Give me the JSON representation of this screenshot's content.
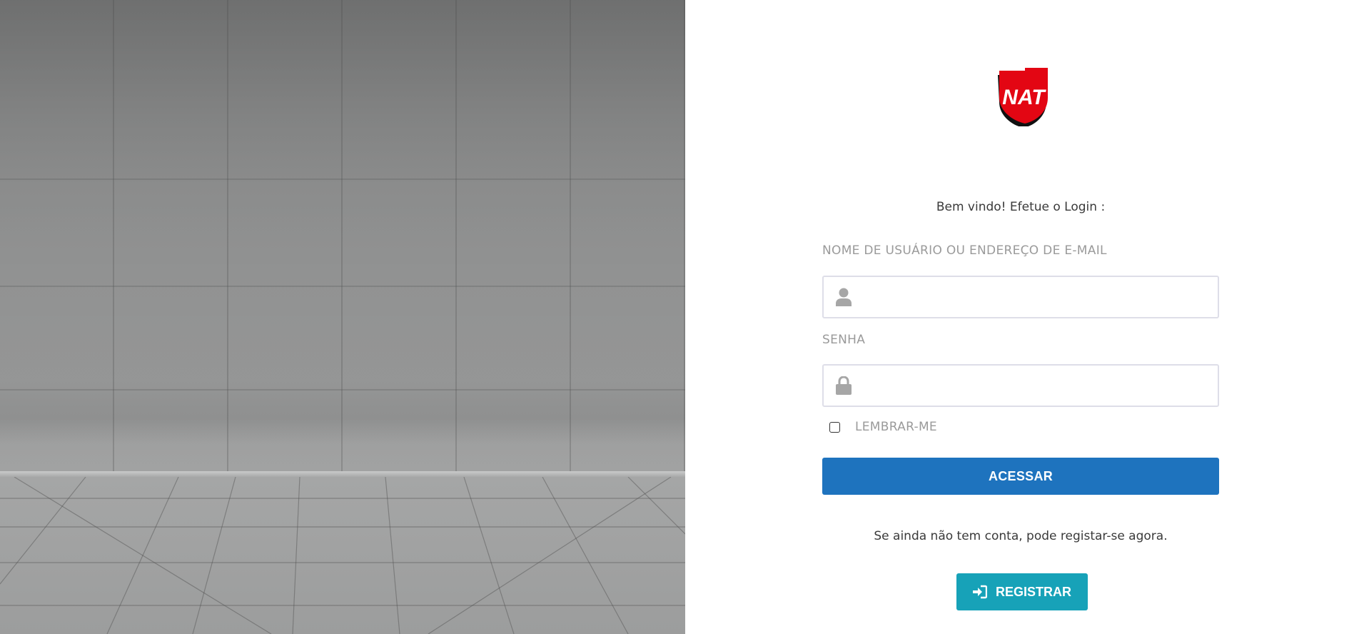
{
  "brand": {
    "logo_text": "NAT",
    "logo_color": "#e30613"
  },
  "login": {
    "welcome_text": "Bem vindo! Efetue o Login :",
    "username_label": "NOME DE USUÁRIO OU ENDEREÇO DE E-MAIL",
    "username_value": "",
    "username_icon": "user-icon",
    "password_label": "SENHA",
    "password_value": "",
    "password_icon": "lock-icon",
    "remember_label": "LEMBRAR-ME",
    "remember_checked": false,
    "submit_label": "ACESSAR",
    "submit_color": "#1e73be"
  },
  "register": {
    "prompt_text": "Se ainda não tem conta, pode registar-se agora.",
    "button_label": "REGISTRAR",
    "button_icon": "sign-in-icon",
    "button_color": "#17a2b8"
  }
}
